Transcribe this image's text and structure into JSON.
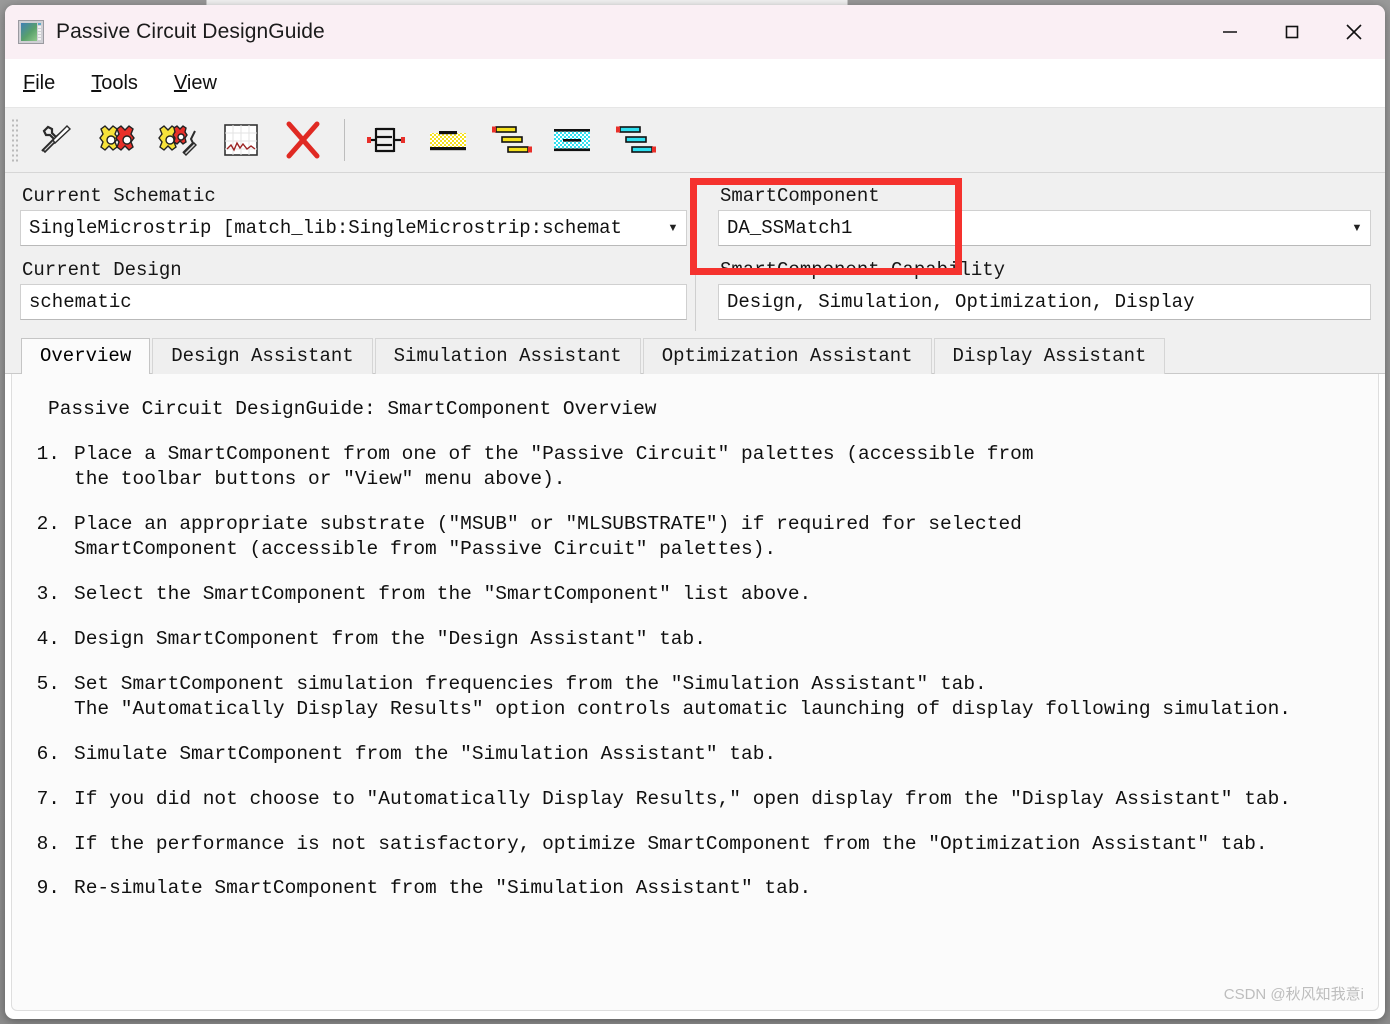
{
  "window": {
    "title": "Passive Circuit DesignGuide",
    "app_icon": "app-window-icon",
    "controls": {
      "minimize": "minimize-icon",
      "maximize": "maximize-icon",
      "close": "close-icon"
    }
  },
  "background": {
    "partial_tab_text": "…"
  },
  "menu": [
    {
      "accel": "F",
      "rest": "ile"
    },
    {
      "accel": "T",
      "rest": "ools"
    },
    {
      "accel": "V",
      "rest": "iew"
    }
  ],
  "toolbar": {
    "buttons": [
      {
        "name": "wrench-tool-icon",
        "tooltip": "Wrench"
      },
      {
        "name": "gears-red-icon",
        "tooltip": "Gears"
      },
      {
        "name": "gears-wrench-icon",
        "tooltip": "Gears with wrench"
      },
      {
        "name": "plot-graph-icon",
        "tooltip": "Display plot"
      },
      {
        "name": "red-x-icon",
        "tooltip": "Delete"
      },
      {
        "name": "ladder-network-icon",
        "tooltip": "Lumped components palette"
      },
      {
        "name": "microstrip-substrate-icon",
        "tooltip": "Microstrip palette"
      },
      {
        "name": "microstrip-lines-icon",
        "tooltip": "Microstrip lines palette"
      },
      {
        "name": "stripline-substrate-icon",
        "tooltip": "Stripline palette"
      },
      {
        "name": "stripline-lines-icon",
        "tooltip": "Stripline lines palette"
      }
    ]
  },
  "fields": {
    "current_schematic": {
      "label": "Current Schematic",
      "value": "SingleMicrostrip [match_lib:SingleMicrostrip:schemat"
    },
    "current_design": {
      "label": "Current Design",
      "value": "schematic"
    },
    "smart_component": {
      "label": "SmartComponent",
      "value": "DA_SSMatch1"
    },
    "smart_component_capability": {
      "label": "SmartComponent Capability",
      "value": "Design, Simulation, Optimization, Display"
    },
    "highlight_color": "#f5322e"
  },
  "tabs": [
    {
      "label": "Overview",
      "active": true
    },
    {
      "label": "Design Assistant",
      "active": false
    },
    {
      "label": "Simulation Assistant",
      "active": false
    },
    {
      "label": "Optimization Assistant",
      "active": false
    },
    {
      "label": "Display Assistant",
      "active": false
    }
  ],
  "content": {
    "title": "Passive Circuit DesignGuide: SmartComponent Overview",
    "steps": [
      {
        "num": "1.",
        "lines": [
          "Place a SmartComponent from one of the \"Passive Circuit\" palettes (accessible from",
          "the toolbar buttons or \"View\" menu above)."
        ]
      },
      {
        "num": "2.",
        "lines": [
          "Place an appropriate substrate (\"MSUB\" or \"MLSUBSTRATE\") if required for selected",
          "SmartComponent (accessible from \"Passive Circuit\" palettes)."
        ]
      },
      {
        "num": "3.",
        "lines": [
          "Select the SmartComponent from the \"SmartComponent\" list above."
        ]
      },
      {
        "num": "4.",
        "lines": [
          "Design SmartComponent from the \"Design Assistant\" tab."
        ]
      },
      {
        "num": "5.",
        "lines": [
          "Set SmartComponent simulation frequencies from the \"Simulation Assistant\" tab.",
          "The \"Automatically Display Results\" option controls automatic launching of display following simulation."
        ]
      },
      {
        "num": "6.",
        "lines": [
          "Simulate SmartComponent from the \"Simulation Assistant\" tab."
        ]
      },
      {
        "num": "7.",
        "lines": [
          "If you did not choose to \"Automatically Display Results,\" open display from the \"Display Assistant\" tab."
        ]
      },
      {
        "num": "8.",
        "lines": [
          "If the performance is not satisfactory, optimize SmartComponent from the \"Optimization Assistant\" tab."
        ]
      },
      {
        "num": "9.",
        "lines": [
          "Re-simulate SmartComponent from the \"Simulation Assistant\" tab."
        ]
      }
    ]
  },
  "watermark": "CSDN @秋风知我意i"
}
